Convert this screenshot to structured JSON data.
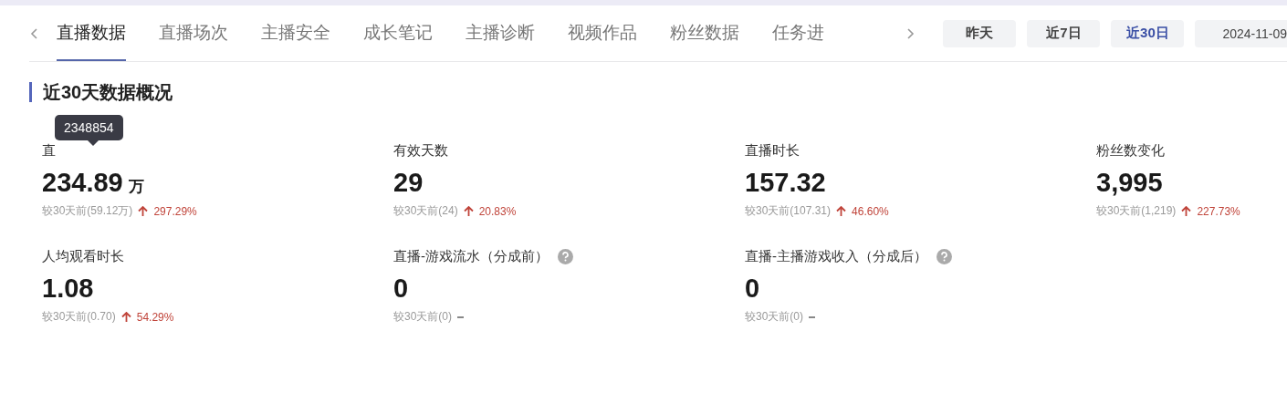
{
  "tabs": [
    {
      "label": "直播数据",
      "selected": true
    },
    {
      "label": "直播场次",
      "selected": false
    },
    {
      "label": "主播安全",
      "selected": false
    },
    {
      "label": "成长笔记",
      "selected": false
    },
    {
      "label": "主播诊断",
      "selected": false
    },
    {
      "label": "视频作品",
      "selected": false
    },
    {
      "label": "粉丝数据",
      "selected": false
    },
    {
      "label": "任务进",
      "selected": false
    }
  ],
  "ranges": [
    {
      "label": "昨天",
      "selected": false
    },
    {
      "label": "近7日",
      "selected": false
    },
    {
      "label": "近30日",
      "selected": true
    }
  ],
  "date": "2024-11-09",
  "section_title": "近30天数据概况",
  "metrics": [
    {
      "label": "直",
      "value": "234.89",
      "unit": "万",
      "tooltip": "2348854",
      "compare": "较30天前(59.12万)",
      "kind": "up",
      "change": "297.29%",
      "help": false
    },
    {
      "label": "有效天数",
      "value": "29",
      "compare": "较30天前(24)",
      "kind": "up",
      "change": "20.83%",
      "help": false
    },
    {
      "label": "直播时长",
      "value": "157.32",
      "compare": "较30天前(107.31)",
      "kind": "up",
      "change": "46.60%",
      "help": false
    },
    {
      "label": "粉丝数变化",
      "value": "3,995",
      "compare": "较30天前(1,219)",
      "kind": "up",
      "change": "227.73%",
      "help": false
    },
    {
      "label": "人均观看时长",
      "value": "1.08",
      "compare": "较30天前(0.70)",
      "kind": "up",
      "change": "54.29%",
      "help": false
    },
    {
      "label": "直播-游戏流水（分成前）",
      "value": "0",
      "compare": "较30天前(0)",
      "kind": "flat",
      "help": true
    },
    {
      "label": "直播-主播游戏收入（分成后）",
      "value": "0",
      "compare": "较30天前(0)",
      "kind": "flat",
      "help": true
    }
  ]
}
